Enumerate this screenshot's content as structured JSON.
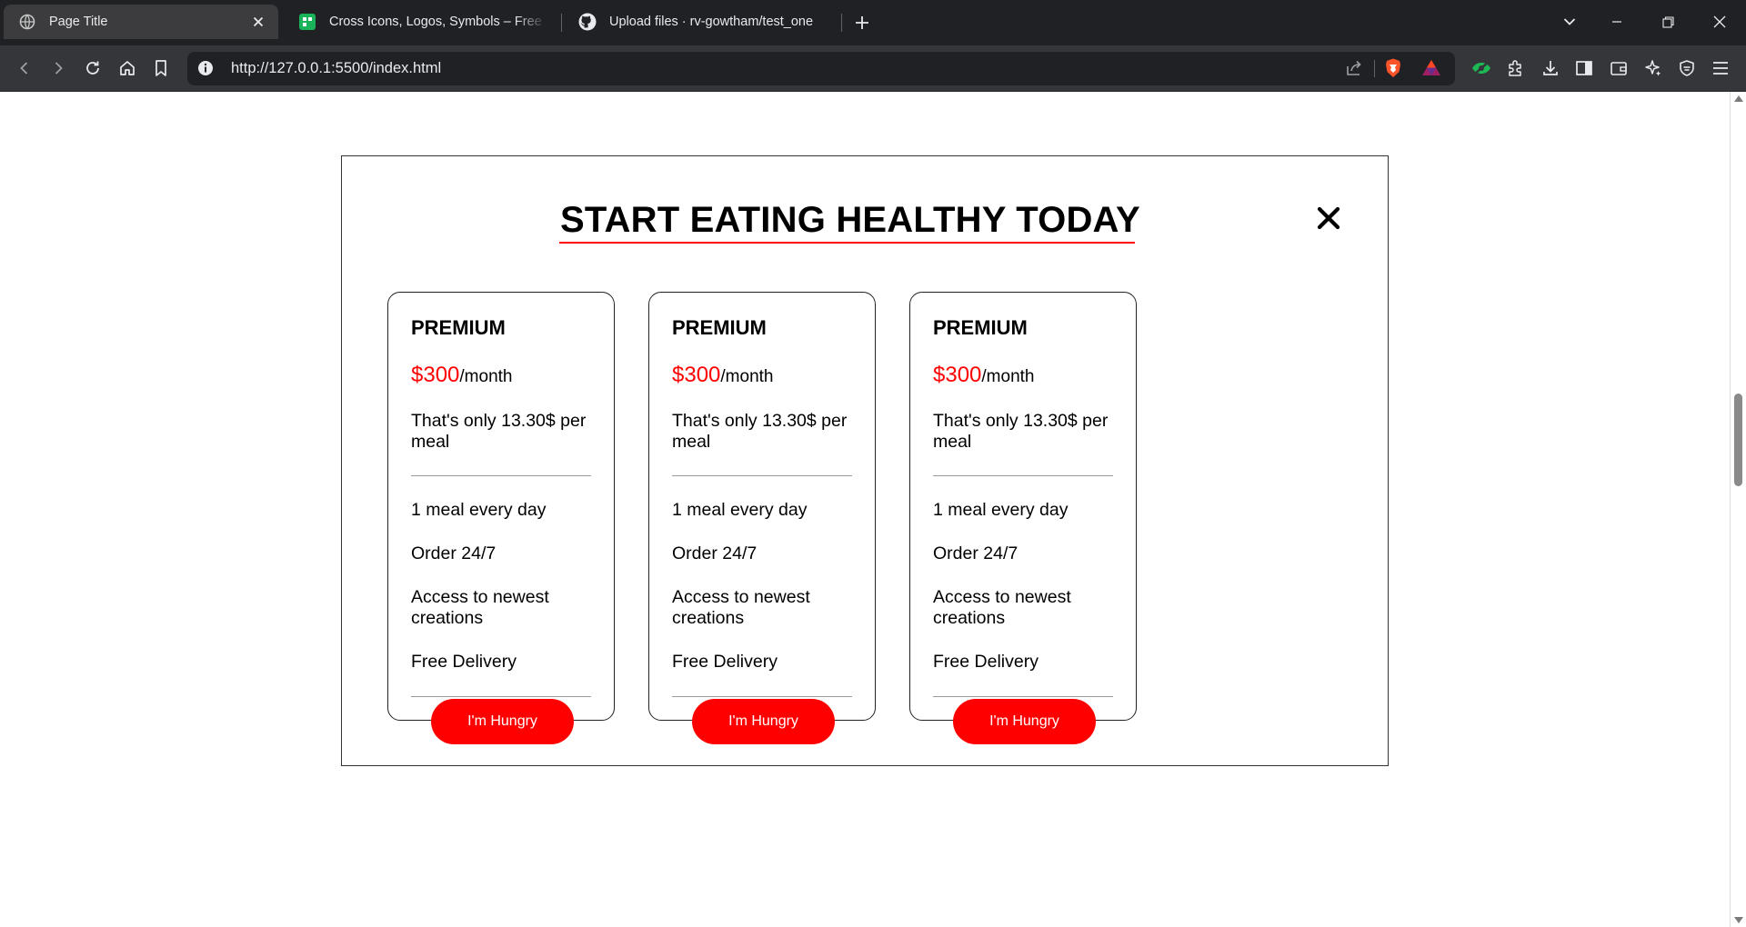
{
  "browser": {
    "tabs": [
      {
        "title": "Page Title",
        "icon": "globe-icon",
        "active": true
      },
      {
        "title": "Cross Icons, Logos, Symbols – Free Do",
        "icon": "site-favicon-icon",
        "active": false
      },
      {
        "title": "Upload files · rv-gowtham/test_one",
        "icon": "github-icon",
        "active": false
      }
    ],
    "new_tab": "+",
    "address": "http://127.0.0.1:5500/index.html"
  },
  "modal": {
    "title": "START EATING HEALTHY TODAY",
    "close_glyph": "×"
  },
  "plans": [
    {
      "name": "PREMIUM",
      "price": "$300",
      "period": "/month",
      "per_meal": "That's only 13.30$ per meal",
      "features": [
        "1 meal every day",
        "Order 24/7",
        "Access to newest creations",
        "Free Delivery"
      ],
      "cta": "I'm Hungry"
    },
    {
      "name": "PREMIUM",
      "price": "$300",
      "period": "/month",
      "per_meal": "That's only 13.30$ per meal",
      "features": [
        "1 meal every day",
        "Order 24/7",
        "Access to newest creations",
        "Free Delivery"
      ],
      "cta": "I'm Hungry"
    },
    {
      "name": "PREMIUM",
      "price": "$300",
      "period": "/month",
      "per_meal": "That's only 13.30$ per meal",
      "features": [
        "1 meal every day",
        "Order 24/7",
        "Access to newest creations",
        "Free Delivery"
      ],
      "cta": "I'm Hungry"
    }
  ],
  "colors": {
    "accent": "#ff0000",
    "tabbar": "#202124",
    "toolbar": "#35363a"
  }
}
